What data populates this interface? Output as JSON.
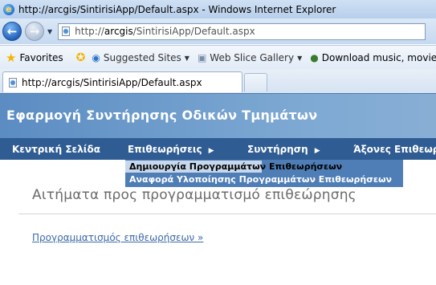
{
  "window": {
    "title": "http://arcgis/SintirisiApp/Default.aspx - Windows Internet Explorer"
  },
  "address_bar": {
    "url_prefix": "http://",
    "url_host": "arcgis",
    "url_path": "/SintirisiApp/Default.aspx"
  },
  "favorites_bar": {
    "favorites_label": "Favorites",
    "items": [
      {
        "label": "Suggested Sites",
        "icon": "ie-page-icon",
        "has_dropdown": true
      },
      {
        "label": "Web Slice Gallery",
        "icon": "web-slice-icon",
        "has_dropdown": true
      },
      {
        "label": "Download music, movies,...",
        "icon": "globe-icon",
        "has_dropdown": false
      }
    ]
  },
  "tab": {
    "label": "http://arcgis/SintirisiApp/Default.aspx"
  },
  "app": {
    "title": "Εφαρμογή Συντήρησης Οδικών Τμημάτων",
    "menu": [
      {
        "label": "Κεντρική Σελίδα",
        "has_submenu": false
      },
      {
        "label": "Επιθεωρήσεις",
        "has_submenu": true
      },
      {
        "label": "Συντήρηση",
        "has_submenu": true
      },
      {
        "label": "Άξονες Επιθεωρ",
        "has_submenu": false
      }
    ],
    "submenu": [
      {
        "label": "Δημιουργία Προγραμμάτων Επιθεωρήσεων",
        "highlighted": true
      },
      {
        "label": "Αναφορά Υλοποίησης Προγραμμάτων Επιθεωρήσεων",
        "highlighted": false
      }
    ],
    "page_heading": "Αιτήματα προς προγραμματισμό επιθεώρησης",
    "page_link": "Προγραμματισμός επιθεωρήσεων »"
  },
  "colors": {
    "header_blue": "#6f9dcc",
    "menu_dark_blue": "#2f5c93",
    "submenu_blue": "#4f7eb6",
    "link_blue": "#3c6aa8"
  }
}
